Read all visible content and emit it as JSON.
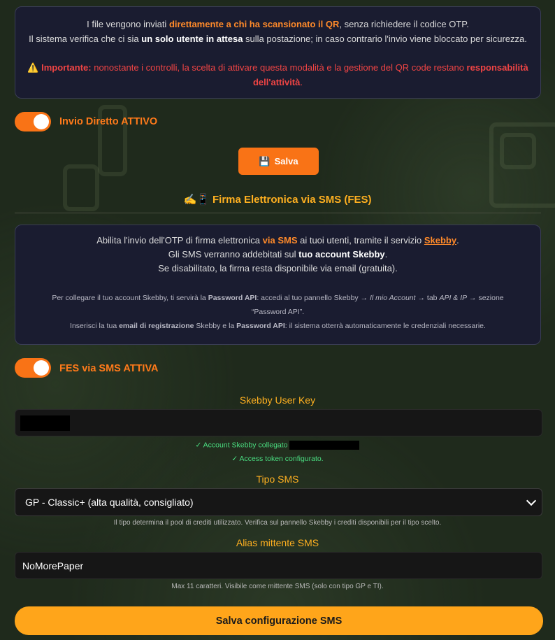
{
  "direct_panel": {
    "line1_pre": "I file vengono inviati ",
    "line1_hl": "direttamente a chi ha scansionato il QR",
    "line1_post": ", senza richiedere il codice OTP.",
    "line2_pre": "Il sistema verifica che ci sia ",
    "line2_hl": "un solo utente in attesa",
    "line2_post": " sulla postazione; in caso contrario l'invio viene bloccato per sicurezza.",
    "warning_icon": "⚠️",
    "warn_bold": "Importante:",
    "warn_text": " nonostante i controlli, la scelta di attivare questa modalità e la gestione del QR code restano ",
    "warn_bold2": "responsabilità dell'attività",
    "warn_end": "."
  },
  "direct_toggle": {
    "label": "Invio Diretto ATTIVO",
    "on": true
  },
  "save_button": {
    "icon": "💾",
    "label": "Salva"
  },
  "fes_section": {
    "icon": "✍️📱",
    "title": "Firma Elettronica via SMS (FES)"
  },
  "fes_panel": {
    "l1_pre": "Abilita l'invio dell'OTP di firma elettronica ",
    "l1_hl": "via SMS",
    "l1_mid": " ai tuoi utenti, tramite il servizio ",
    "l1_link": "Skebby",
    "l1_end": ".",
    "l2_pre": "Gli SMS verranno addebitati sul ",
    "l2_hl": "tuo account Skebby",
    "l2_end": ".",
    "l3": "Se disabilitato, la firma resta disponibile via email (gratuita).",
    "s1_pre": "Per collegare il tuo account Skebby, ti servirà la ",
    "s1_b": "Password API",
    "s1_mid": ": accedi al tuo pannello Skebby → ",
    "s1_i1": "Il mio Account",
    "s1_mid2": " → tab ",
    "s1_i2": "API & IP",
    "s1_end": " → sezione",
    "s2": "“Password API”.",
    "s3_pre": "Inserisci la tua ",
    "s3_b1": "email di registrazione",
    "s3_mid": " Skebby e la ",
    "s3_b2": "Password API",
    "s3_end": ": il sistema otterrà automaticamente le credenziali necessarie."
  },
  "fes_toggle": {
    "label": "FES via SMS ATTIVA",
    "on": true
  },
  "user_key": {
    "label": "Skebby User Key"
  },
  "status": {
    "linked": "✓ Account Skebby collegato",
    "token": "✓ Access token configurato."
  },
  "sms_type": {
    "label": "Tipo SMS",
    "selected": "GP - Classic+ (alta qualità, consigliato)",
    "hint": "Il tipo determina il pool di crediti utilizzato. Verifica sul pannello Skebby i crediti disponibili per il tipo scelto."
  },
  "alias": {
    "label": "Alias mittente SMS",
    "value": "NoMorePaper",
    "hint": "Max 11 caratteri. Visibile come mittente SMS (solo con tipo GP e TI)."
  },
  "submit": {
    "label": "Salva configurazione SMS"
  },
  "colors": {
    "accent": "#f97316",
    "title": "#ffb020",
    "success": "#4ade80",
    "warning": "#ef4444"
  }
}
